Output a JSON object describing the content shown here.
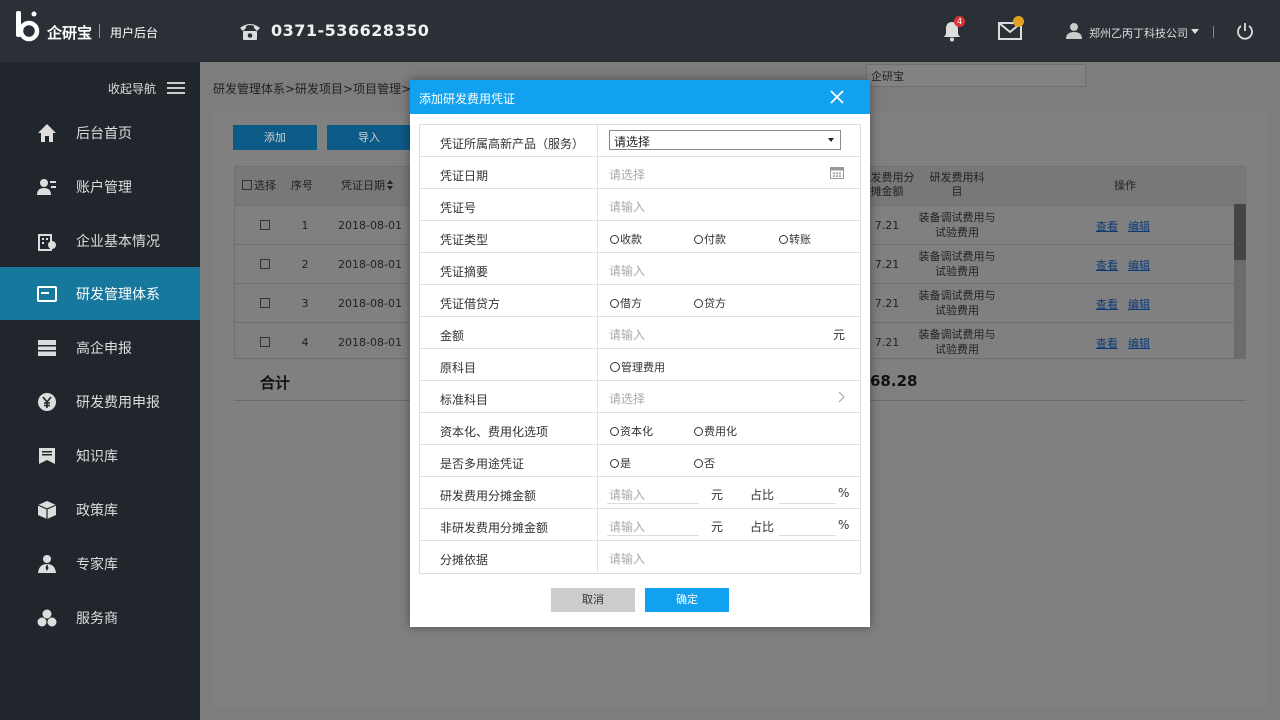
{
  "header": {
    "brand": "企研宝",
    "subtitle": "用户后台",
    "phone": "0371-536628350",
    "notifications_count": "4",
    "messages_count": "",
    "company": "郑州乙丙丁科技公司"
  },
  "sidebar": {
    "collapse_label": "收起导航",
    "items": [
      {
        "label": "后台首页",
        "icon": "home-icon"
      },
      {
        "label": "账户管理",
        "icon": "account-icon"
      },
      {
        "label": "企业基本情况",
        "icon": "company-icon"
      },
      {
        "label": "研发管理体系",
        "icon": "card-icon",
        "active": true
      },
      {
        "label": "高企申报",
        "icon": "list-icon"
      },
      {
        "label": "研发费用申报",
        "icon": "yen-icon"
      },
      {
        "label": "知识库",
        "icon": "book-icon"
      },
      {
        "label": "政策库",
        "icon": "box-icon"
      },
      {
        "label": "专家库",
        "icon": "expert-icon"
      },
      {
        "label": "服务商",
        "icon": "provider-icon"
      }
    ]
  },
  "main": {
    "breadcrumb": "研发管理体系>研发项目>项目管理>研",
    "add_button": "添加",
    "import_button": "导入",
    "search_value": "企研宝",
    "table": {
      "headers": {
        "select": "选择",
        "index": "序号",
        "date": "凭证日期",
        "rd_alloc": "研发费用分摊金额",
        "rd_subject": "研发费用科目",
        "actions": "操作"
      },
      "rows": [
        {
          "index": "1",
          "date": "2018-08-01",
          "amount": "7.21",
          "subject": "装备调试费用与试验费用",
          "view": "查看",
          "edit": "编辑"
        },
        {
          "index": "2",
          "date": "2018-08-01",
          "amount": "7.21",
          "subject": "装备调试费用与试验费用",
          "view": "查看",
          "edit": "编辑"
        },
        {
          "index": "3",
          "date": "2018-08-01",
          "amount": "7.21",
          "subject": "装备调试费用与试验费用",
          "view": "查看",
          "edit": "编辑"
        },
        {
          "index": "4",
          "date": "2018-08-01",
          "amount": "7.21",
          "subject": "装备调试费用与试验费用",
          "view": "查看",
          "edit": "编辑"
        }
      ]
    },
    "total_label": "合计",
    "total_value": "68.28"
  },
  "modal": {
    "title": "添加研发费用凭证",
    "fields": {
      "product_label": "凭证所属高新产品（服务）",
      "product_value": "请选择",
      "date_label": "凭证日期",
      "date_placeholder": "请选择",
      "number_label": "凭证号",
      "number_placeholder": "请输入",
      "type_label": "凭证类型",
      "type_options": [
        "收款",
        "付款",
        "转账"
      ],
      "summary_label": "凭证摘要",
      "summary_placeholder": "请输入",
      "debit_label": "凭证借贷方",
      "debit_options": [
        "借方",
        "贷方"
      ],
      "amount_label": "金额",
      "amount_placeholder": "请输入",
      "amount_unit": "元",
      "orig_subject_label": "原科目",
      "orig_subject_check": "管理费用",
      "std_subject_label": "标准科目",
      "std_subject_placeholder": "请选择",
      "cap_label": "资本化、费用化选项",
      "cap_options": [
        "资本化",
        "费用化"
      ],
      "multi_label": "是否多用途凭证",
      "multi_options": [
        "是",
        "否"
      ],
      "rd_alloc_label": "研发费用分摊金额",
      "rd_alloc_placeholder": "请输入",
      "nonrd_alloc_label": "非研发费用分摊金额",
      "nonrd_alloc_placeholder": "请输入",
      "yuan": "元",
      "ratio": "占比",
      "percent": "%",
      "basis_label": "分摊依据",
      "basis_placeholder": "请输入"
    },
    "cancel_label": "取消",
    "ok_label": "确定"
  }
}
